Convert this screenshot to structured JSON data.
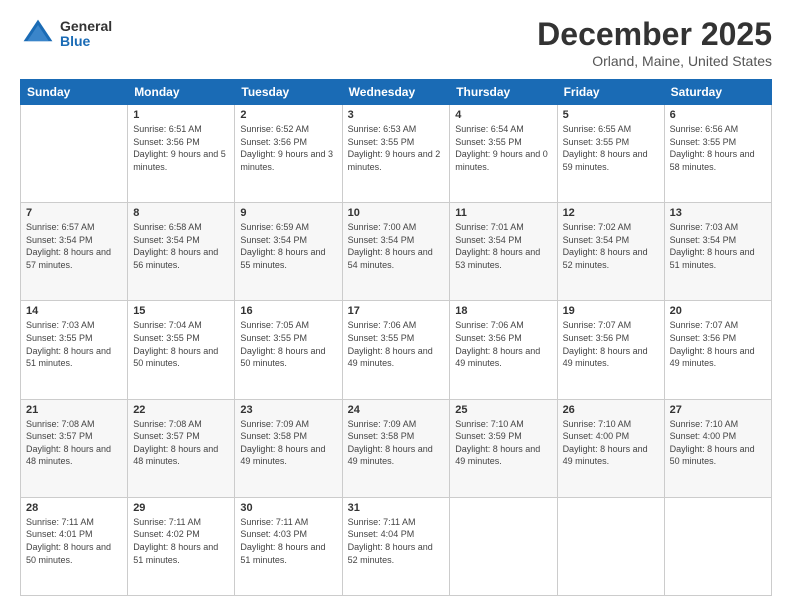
{
  "logo": {
    "general": "General",
    "blue": "Blue"
  },
  "header": {
    "month": "December 2025",
    "location": "Orland, Maine, United States"
  },
  "days_of_week": [
    "Sunday",
    "Monday",
    "Tuesday",
    "Wednesday",
    "Thursday",
    "Friday",
    "Saturday"
  ],
  "weeks": [
    [
      {
        "day": "",
        "sunrise": "",
        "sunset": "",
        "daylight": ""
      },
      {
        "day": "1",
        "sunrise": "Sunrise: 6:51 AM",
        "sunset": "Sunset: 3:56 PM",
        "daylight": "Daylight: 9 hours and 5 minutes."
      },
      {
        "day": "2",
        "sunrise": "Sunrise: 6:52 AM",
        "sunset": "Sunset: 3:56 PM",
        "daylight": "Daylight: 9 hours and 3 minutes."
      },
      {
        "day": "3",
        "sunrise": "Sunrise: 6:53 AM",
        "sunset": "Sunset: 3:55 PM",
        "daylight": "Daylight: 9 hours and 2 minutes."
      },
      {
        "day": "4",
        "sunrise": "Sunrise: 6:54 AM",
        "sunset": "Sunset: 3:55 PM",
        "daylight": "Daylight: 9 hours and 0 minutes."
      },
      {
        "day": "5",
        "sunrise": "Sunrise: 6:55 AM",
        "sunset": "Sunset: 3:55 PM",
        "daylight": "Daylight: 8 hours and 59 minutes."
      },
      {
        "day": "6",
        "sunrise": "Sunrise: 6:56 AM",
        "sunset": "Sunset: 3:55 PM",
        "daylight": "Daylight: 8 hours and 58 minutes."
      }
    ],
    [
      {
        "day": "7",
        "sunrise": "Sunrise: 6:57 AM",
        "sunset": "Sunset: 3:54 PM",
        "daylight": "Daylight: 8 hours and 57 minutes."
      },
      {
        "day": "8",
        "sunrise": "Sunrise: 6:58 AM",
        "sunset": "Sunset: 3:54 PM",
        "daylight": "Daylight: 8 hours and 56 minutes."
      },
      {
        "day": "9",
        "sunrise": "Sunrise: 6:59 AM",
        "sunset": "Sunset: 3:54 PM",
        "daylight": "Daylight: 8 hours and 55 minutes."
      },
      {
        "day": "10",
        "sunrise": "Sunrise: 7:00 AM",
        "sunset": "Sunset: 3:54 PM",
        "daylight": "Daylight: 8 hours and 54 minutes."
      },
      {
        "day": "11",
        "sunrise": "Sunrise: 7:01 AM",
        "sunset": "Sunset: 3:54 PM",
        "daylight": "Daylight: 8 hours and 53 minutes."
      },
      {
        "day": "12",
        "sunrise": "Sunrise: 7:02 AM",
        "sunset": "Sunset: 3:54 PM",
        "daylight": "Daylight: 8 hours and 52 minutes."
      },
      {
        "day": "13",
        "sunrise": "Sunrise: 7:03 AM",
        "sunset": "Sunset: 3:54 PM",
        "daylight": "Daylight: 8 hours and 51 minutes."
      }
    ],
    [
      {
        "day": "14",
        "sunrise": "Sunrise: 7:03 AM",
        "sunset": "Sunset: 3:55 PM",
        "daylight": "Daylight: 8 hours and 51 minutes."
      },
      {
        "day": "15",
        "sunrise": "Sunrise: 7:04 AM",
        "sunset": "Sunset: 3:55 PM",
        "daylight": "Daylight: 8 hours and 50 minutes."
      },
      {
        "day": "16",
        "sunrise": "Sunrise: 7:05 AM",
        "sunset": "Sunset: 3:55 PM",
        "daylight": "Daylight: 8 hours and 50 minutes."
      },
      {
        "day": "17",
        "sunrise": "Sunrise: 7:06 AM",
        "sunset": "Sunset: 3:55 PM",
        "daylight": "Daylight: 8 hours and 49 minutes."
      },
      {
        "day": "18",
        "sunrise": "Sunrise: 7:06 AM",
        "sunset": "Sunset: 3:56 PM",
        "daylight": "Daylight: 8 hours and 49 minutes."
      },
      {
        "day": "19",
        "sunrise": "Sunrise: 7:07 AM",
        "sunset": "Sunset: 3:56 PM",
        "daylight": "Daylight: 8 hours and 49 minutes."
      },
      {
        "day": "20",
        "sunrise": "Sunrise: 7:07 AM",
        "sunset": "Sunset: 3:56 PM",
        "daylight": "Daylight: 8 hours and 49 minutes."
      }
    ],
    [
      {
        "day": "21",
        "sunrise": "Sunrise: 7:08 AM",
        "sunset": "Sunset: 3:57 PM",
        "daylight": "Daylight: 8 hours and 48 minutes."
      },
      {
        "day": "22",
        "sunrise": "Sunrise: 7:08 AM",
        "sunset": "Sunset: 3:57 PM",
        "daylight": "Daylight: 8 hours and 48 minutes."
      },
      {
        "day": "23",
        "sunrise": "Sunrise: 7:09 AM",
        "sunset": "Sunset: 3:58 PM",
        "daylight": "Daylight: 8 hours and 49 minutes."
      },
      {
        "day": "24",
        "sunrise": "Sunrise: 7:09 AM",
        "sunset": "Sunset: 3:58 PM",
        "daylight": "Daylight: 8 hours and 49 minutes."
      },
      {
        "day": "25",
        "sunrise": "Sunrise: 7:10 AM",
        "sunset": "Sunset: 3:59 PM",
        "daylight": "Daylight: 8 hours and 49 minutes."
      },
      {
        "day": "26",
        "sunrise": "Sunrise: 7:10 AM",
        "sunset": "Sunset: 4:00 PM",
        "daylight": "Daylight: 8 hours and 49 minutes."
      },
      {
        "day": "27",
        "sunrise": "Sunrise: 7:10 AM",
        "sunset": "Sunset: 4:00 PM",
        "daylight": "Daylight: 8 hours and 50 minutes."
      }
    ],
    [
      {
        "day": "28",
        "sunrise": "Sunrise: 7:11 AM",
        "sunset": "Sunset: 4:01 PM",
        "daylight": "Daylight: 8 hours and 50 minutes."
      },
      {
        "day": "29",
        "sunrise": "Sunrise: 7:11 AM",
        "sunset": "Sunset: 4:02 PM",
        "daylight": "Daylight: 8 hours and 51 minutes."
      },
      {
        "day": "30",
        "sunrise": "Sunrise: 7:11 AM",
        "sunset": "Sunset: 4:03 PM",
        "daylight": "Daylight: 8 hours and 51 minutes."
      },
      {
        "day": "31",
        "sunrise": "Sunrise: 7:11 AM",
        "sunset": "Sunset: 4:04 PM",
        "daylight": "Daylight: 8 hours and 52 minutes."
      },
      {
        "day": "",
        "sunrise": "",
        "sunset": "",
        "daylight": ""
      },
      {
        "day": "",
        "sunrise": "",
        "sunset": "",
        "daylight": ""
      },
      {
        "day": "",
        "sunrise": "",
        "sunset": "",
        "daylight": ""
      }
    ]
  ]
}
